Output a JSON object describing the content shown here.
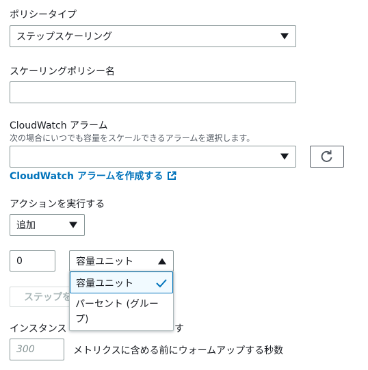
{
  "policy_type": {
    "label": "ポリシータイプ",
    "selected": "ステップスケーリング"
  },
  "policy_name": {
    "label": "スケーリングポリシー名",
    "value": ""
  },
  "cloudwatch_alarm": {
    "label": "CloudWatch アラーム",
    "description": "次の場合にいつでも容量をスケールできるアラームを選択します。",
    "selected": "",
    "refresh_icon": "refresh-icon",
    "create_link": "CloudWatch アラームを作成する",
    "external_icon": "external-link-icon"
  },
  "action": {
    "label": "アクションを実行する",
    "selected": "追加",
    "amount_value": "0",
    "unit_selected": "容量ユニット",
    "unit_options": [
      "容量ユニット",
      "パーセント (グループ)"
    ],
    "add_step_button": "ステップを",
    "partial_label": "インスタンス",
    "partial_label_tail": "す"
  },
  "warmup": {
    "placeholder": "300",
    "suffix": "メトリクスに含める前にウォームアップする秒数"
  },
  "colors": {
    "link": "#0073bb",
    "border": "#879596",
    "selected_border": "#0073bb",
    "text": "#16191f"
  }
}
